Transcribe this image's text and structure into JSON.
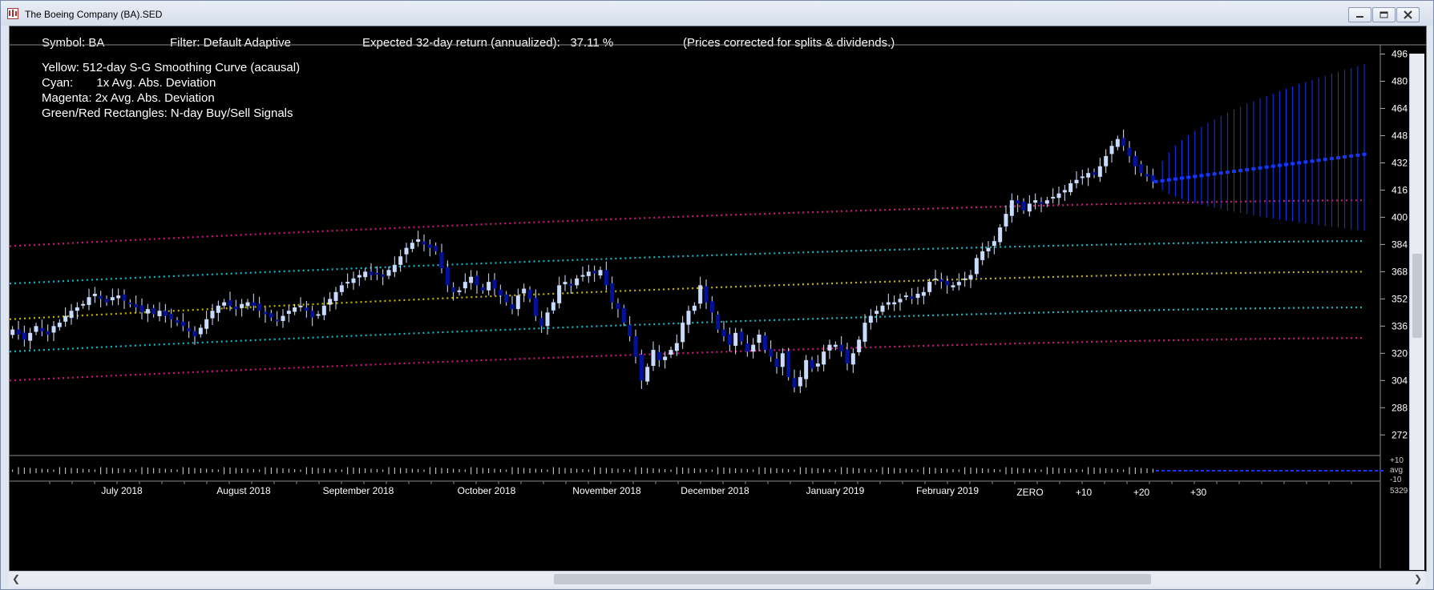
{
  "window": {
    "title": "The Boeing Company (BA).SED",
    "buttons": {
      "minimize": "minimize",
      "maximize": "maximize",
      "close": "close"
    }
  },
  "header": {
    "symbol": "Symbol: BA",
    "filter": "Filter: Default Adaptive",
    "expected_return": "Expected 32-day return (annualized):   37.11 %",
    "note": "(Prices corrected for splits & dividends.)"
  },
  "legend": [
    "Yellow: 512-day S-G Smoothing Curve (acausal)",
    "Cyan:       1x Avg. Abs. Deviation",
    "Magenta: 2x Avg. Abs. Deviation",
    "Green/Red Rectangles: N-day Buy/Sell Signals"
  ],
  "colors": {
    "background": "#000000",
    "smoothing": "#c8b400",
    "dev1": "#19b4c8",
    "dev2": "#c8197d",
    "candle_up": "#c8dcff",
    "candle_down": "#00129c",
    "forecast": "#1437ff"
  },
  "chart_data": {
    "type": "candlestick",
    "y_ticks": [
      496,
      480,
      464,
      448,
      432,
      416,
      400,
      384,
      368,
      352,
      336,
      320,
      304,
      288,
      272
    ],
    "ylim": [
      258,
      500
    ],
    "x_labels": [
      "July 2018",
      "August 2018",
      "September 2018",
      "October 2018",
      "November 2018",
      "December 2018",
      "January 2019",
      "February 2019"
    ],
    "forecast_labels": [
      "ZERO",
      "+10",
      "+20",
      "+30"
    ],
    "lower_panel_labels": [
      "+10",
      "avg",
      "-10",
      "5329"
    ],
    "closes": [
      334,
      331,
      328,
      332,
      336,
      333,
      331,
      336,
      338,
      342,
      345,
      347,
      349,
      353,
      355,
      352,
      350,
      353,
      354,
      351,
      349,
      347,
      344,
      346,
      343,
      345,
      342,
      340,
      338,
      336,
      333,
      330,
      335,
      340,
      345,
      348,
      350,
      348,
      346,
      349,
      350,
      348,
      345,
      343,
      341,
      339,
      342,
      345,
      347,
      348,
      345,
      341,
      343,
      348,
      352,
      356,
      360,
      362,
      364,
      366,
      368,
      366,
      367,
      365,
      369,
      372,
      377,
      382,
      385,
      387,
      384,
      382,
      380,
      370,
      360,
      356,
      357,
      362,
      365,
      360,
      357,
      362,
      358,
      354,
      350,
      346,
      354,
      358,
      352,
      342,
      336,
      344,
      350,
      360,
      362,
      360,
      364,
      366,
      368,
      367,
      369,
      360,
      350,
      346,
      338,
      330,
      318,
      304,
      312,
      322,
      316,
      318,
      322,
      326,
      338,
      345,
      348,
      360,
      350,
      344,
      334,
      330,
      325,
      332,
      327,
      321,
      325,
      331,
      322,
      318,
      312,
      320,
      306,
      300,
      306,
      316,
      311,
      314,
      321,
      325,
      325,
      321,
      314,
      320,
      328,
      338,
      342,
      345,
      348,
      350,
      350,
      352,
      354,
      352,
      355,
      356,
      362,
      364,
      362,
      360,
      360,
      362,
      364,
      366,
      376,
      380,
      382,
      386,
      394,
      402,
      410,
      408,
      404,
      408,
      410,
      408,
      410,
      412,
      414,
      416,
      420,
      422,
      424,
      426,
      425,
      430,
      436,
      442,
      446,
      442,
      436,
      430,
      426,
      424,
      421
    ],
    "forecast": {
      "start": 421,
      "end": 437,
      "upper_end": 490,
      "lower_end": 392,
      "steps": 32
    },
    "bands": {
      "smoothing": [
        340,
        368
      ],
      "dev1_upper": [
        361,
        386
      ],
      "dev1_lower": [
        321,
        347
      ],
      "dev2_upper": [
        383,
        410
      ],
      "dev2_lower": [
        304,
        329
      ]
    }
  }
}
